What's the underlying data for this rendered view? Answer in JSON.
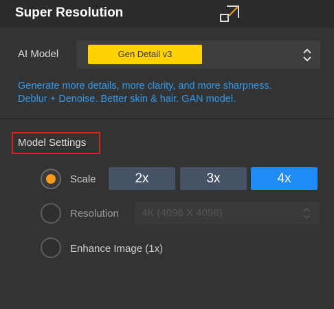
{
  "header": {
    "title": "Super Resolution",
    "expand_icon": "expand-diagonal-icon"
  },
  "ai_model": {
    "label": "AI Model",
    "selected": "Gen Detail v3",
    "chip_color": "#ffd200"
  },
  "description": {
    "line1": "Generate more details, more clarity, and more sharpness.",
    "line2": "Deblur + Denoise. Better skin & hair. GAN model."
  },
  "model_settings": {
    "title": "Model Settings",
    "options": [
      {
        "label": "Scale",
        "checked": true
      },
      {
        "label": "Resolution",
        "checked": false
      },
      {
        "label": "Enhance Image (1x)",
        "checked": false
      }
    ],
    "scale_buttons": [
      {
        "label": "2x",
        "active": false
      },
      {
        "label": "3x",
        "active": false
      },
      {
        "label": "4x",
        "active": true
      }
    ],
    "resolution_value": "4K (4096 X 4096)"
  },
  "colors": {
    "accent_blue": "#1f8cf5",
    "radio_orange": "#f59a1a",
    "highlight_red": "#e02020"
  }
}
